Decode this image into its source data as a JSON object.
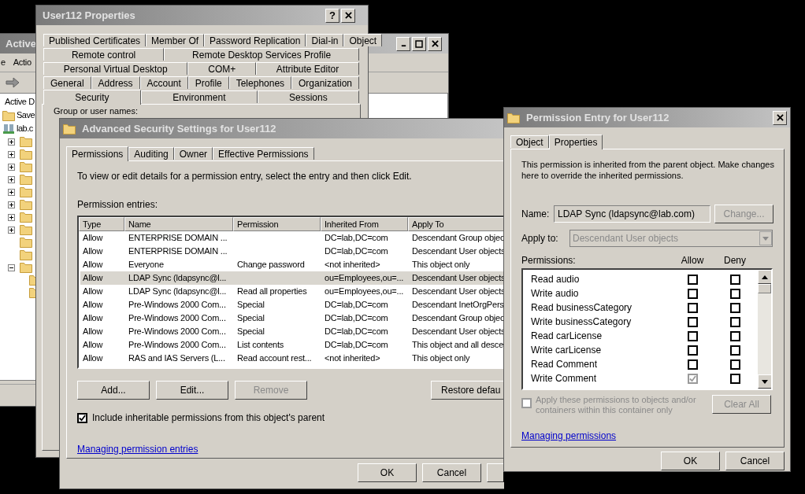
{
  "aduc_window": {
    "title": "Active",
    "menu": [
      "e",
      "Actio"
    ],
    "tree_root": "Active D",
    "tree": [
      {
        "label": "Save",
        "kind": "folder"
      },
      {
        "label": "lab.c",
        "kind": "domain"
      }
    ],
    "nodes": [
      {
        "kind": "branch",
        "expanded": false
      },
      {
        "kind": "branch",
        "expanded": false
      },
      {
        "kind": "branch",
        "expanded": false
      },
      {
        "kind": "branch",
        "expanded": false
      },
      {
        "kind": "branch",
        "expanded": false
      },
      {
        "kind": "branch",
        "expanded": false
      },
      {
        "kind": "branch",
        "expanded": false
      },
      {
        "kind": "branch",
        "expanded": false
      },
      {
        "kind": "leaf"
      },
      {
        "kind": "leaf"
      },
      {
        "kind": "branch",
        "expanded": true,
        "children": [
          {
            "kind": "leaf"
          },
          {
            "kind": "leaf"
          }
        ]
      }
    ]
  },
  "properties_window": {
    "title": "User112 Properties",
    "help_button": "?",
    "tab_rows": [
      [
        {
          "label": "Published Certificates",
          "selected": false
        },
        {
          "label": "Member Of",
          "selected": false
        },
        {
          "label": "Password Replication",
          "selected": false
        },
        {
          "label": "Dial-in",
          "selected": false
        },
        {
          "label": "Object",
          "selected": false
        }
      ],
      [
        {
          "label": "Remote control",
          "selected": false
        },
        {
          "label": "Remote Desktop Services Profile",
          "selected": false
        }
      ],
      [
        {
          "label": "Personal Virtual Desktop",
          "selected": false
        },
        {
          "label": "COM+",
          "selected": false
        },
        {
          "label": "Attribute Editor",
          "selected": false
        }
      ],
      [
        {
          "label": "General",
          "selected": false
        },
        {
          "label": "Address",
          "selected": false
        },
        {
          "label": "Account",
          "selected": false
        },
        {
          "label": "Profile",
          "selected": false
        },
        {
          "label": "Telephones",
          "selected": false
        },
        {
          "label": "Organization",
          "selected": false
        }
      ],
      [
        {
          "label": "Security",
          "selected": true
        },
        {
          "label": "Environment",
          "selected": false
        },
        {
          "label": "Sessions",
          "selected": false
        }
      ]
    ],
    "group_label": "Group or user names:"
  },
  "advanced_window": {
    "title": "Advanced Security Settings for User112",
    "tabs": [
      {
        "label": "Permissions",
        "selected": true
      },
      {
        "label": "Auditing",
        "selected": false
      },
      {
        "label": "Owner",
        "selected": false
      },
      {
        "label": "Effective Permissions",
        "selected": false
      }
    ],
    "instructions": "To view or edit details for a permission entry, select the entry and then click Edit.",
    "entries_label": "Permission entries:",
    "columns": [
      "Type",
      "Name",
      "Permission",
      "Inherited From",
      "Apply To"
    ],
    "rows": [
      {
        "cells": [
          "Allow",
          "ENTERPRISE DOMAIN ...",
          "",
          "DC=lab,DC=com",
          "Descendant Group objec"
        ],
        "selected": false
      },
      {
        "cells": [
          "Allow",
          "ENTERPRISE DOMAIN ...",
          "",
          "DC=lab,DC=com",
          "Descendant User objects"
        ],
        "selected": false
      },
      {
        "cells": [
          "Allow",
          "Everyone",
          "Change password",
          "<not inherited>",
          "This object only"
        ],
        "selected": false
      },
      {
        "cells": [
          "Allow",
          "LDAP Sync (ldapsync@l...",
          "",
          "ou=Employees,ou=...",
          "Descendant User objects"
        ],
        "selected": true
      },
      {
        "cells": [
          "Allow",
          "LDAP Sync (ldapsync@l...",
          "Read all properties",
          "ou=Employees,ou=...",
          "Descendant User objects"
        ],
        "selected": false
      },
      {
        "cells": [
          "Allow",
          "Pre-Windows 2000 Com...",
          "Special",
          "DC=lab,DC=com",
          "Descendant InetOrgPers"
        ],
        "selected": false
      },
      {
        "cells": [
          "Allow",
          "Pre-Windows 2000 Com...",
          "Special",
          "DC=lab,DC=com",
          "Descendant Group objec"
        ],
        "selected": false
      },
      {
        "cells": [
          "Allow",
          "Pre-Windows 2000 Com...",
          "Special",
          "DC=lab,DC=com",
          "Descendant User objects"
        ],
        "selected": false
      },
      {
        "cells": [
          "Allow",
          "Pre-Windows 2000 Com...",
          "List contents",
          "DC=lab,DC=com",
          "This object and all desce"
        ],
        "selected": false
      },
      {
        "cells": [
          "Allow",
          "RAS and IAS Servers (L...",
          "Read account rest...",
          "<not inherited>",
          "This object only"
        ],
        "selected": false
      }
    ],
    "buttons": [
      {
        "label": "Add...",
        "disabled": false
      },
      {
        "label": "Edit...",
        "disabled": false
      },
      {
        "label": "Remove",
        "disabled": true
      }
    ],
    "restore_button": "Restore defau",
    "include_inheritable": {
      "label": "Include inheritable permissions from this object's parent",
      "checked": true
    },
    "link": "Managing permission entries",
    "footer_buttons": [
      "OK",
      "Cancel"
    ]
  },
  "entry_window": {
    "title": "Permission Entry for User112",
    "tabs": [
      {
        "label": "Object",
        "selected": false
      },
      {
        "label": "Properties",
        "selected": true
      }
    ],
    "message": "This permission is inherited from the parent object. Make changes here to override the inherited permissions.",
    "name_label": "Name:",
    "name_value": "LDAP Sync (ldapsync@lab.com)",
    "change_button": {
      "label": "Change...",
      "disabled": true
    },
    "apply_label": "Apply to:",
    "apply_value": {
      "value": "Descendant User objects",
      "disabled": true
    },
    "permissions_label": "Permissions:",
    "allow_header": "Allow",
    "deny_header": "Deny",
    "permissions": [
      {
        "name": "Read audio",
        "allow_checked": false,
        "allow_disabled": false,
        "deny_checked": false,
        "deny_disabled": false
      },
      {
        "name": "Write audio",
        "allow_checked": false,
        "allow_disabled": false,
        "deny_checked": false,
        "deny_disabled": false
      },
      {
        "name": "Read businessCategory",
        "allow_checked": false,
        "allow_disabled": false,
        "deny_checked": false,
        "deny_disabled": false
      },
      {
        "name": "Write businessCategory",
        "allow_checked": false,
        "allow_disabled": false,
        "deny_checked": false,
        "deny_disabled": false
      },
      {
        "name": "Read carLicense",
        "allow_checked": false,
        "allow_disabled": false,
        "deny_checked": false,
        "deny_disabled": false
      },
      {
        "name": "Write carLicense",
        "allow_checked": false,
        "allow_disabled": false,
        "deny_checked": false,
        "deny_disabled": false
      },
      {
        "name": "Read Comment",
        "allow_checked": false,
        "allow_disabled": false,
        "deny_checked": false,
        "deny_disabled": false
      },
      {
        "name": "Write Comment",
        "allow_checked": true,
        "allow_disabled": true,
        "deny_checked": false,
        "deny_disabled": false
      }
    ],
    "apply_within": {
      "label": "Apply these permissions to objects and/or containers within this container only",
      "checked": false,
      "disabled": true
    },
    "clear_all": {
      "label": "Clear All",
      "disabled": true
    },
    "link": "Managing permissions",
    "buttons": [
      "OK",
      "Cancel"
    ]
  }
}
